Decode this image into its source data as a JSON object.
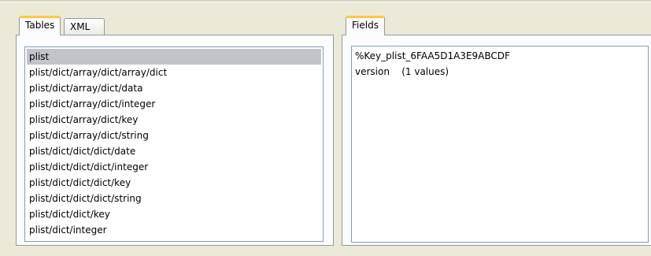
{
  "left_panel": {
    "tabs": [
      {
        "label": "Tables",
        "active": true
      },
      {
        "label": "XML",
        "active": false
      }
    ],
    "tables": [
      "plist",
      "plist/dict/array/dict/array/dict",
      "plist/dict/array/dict/data",
      "plist/dict/array/dict/integer",
      "plist/dict/array/dict/key",
      "plist/dict/array/dict/string",
      "plist/dict/dict/dict/date",
      "plist/dict/dict/dict/integer",
      "plist/dict/dict/dict/key",
      "plist/dict/dict/dict/string",
      "plist/dict/dict/key",
      "plist/dict/integer"
    ],
    "selected_table": "plist"
  },
  "right_panel": {
    "tabs": [
      {
        "label": "Fields",
        "active": true
      }
    ],
    "fields": [
      "%Key_plist_6FAA5D1A3E9ABCDF",
      "version    (1 values)"
    ]
  },
  "colors": {
    "background": "#ece9d8",
    "active_tab_accent": "#ffc83c",
    "selection": "#c1c4c9",
    "list_border": "#7f9db9"
  }
}
